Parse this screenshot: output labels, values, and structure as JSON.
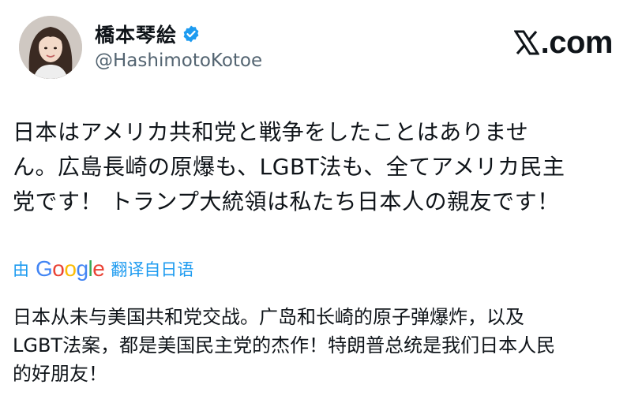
{
  "author": {
    "display_name": "橋本琴絵",
    "handle": "@HashimotoKotoe",
    "verified": true,
    "avatar_icon": "profile-photo-avatar"
  },
  "site": {
    "logo_text": ".com",
    "logo_icon": "x-logo-icon"
  },
  "post": {
    "original_lines": [
      "日本はアメリカ共和党と戦争をしたことはありませ",
      "ん。広島長崎の原爆も、LGBT法も、全てアメリカ民主",
      "党です！ トランプ大統領は私たち日本人の親友です！"
    ],
    "translation_prefix": "由",
    "translation_provider": "Google",
    "translation_suffix": "翻译自日语",
    "translated_lines": [
      "日本从未与美国共和党交战。广岛和长崎的原子弹爆炸，以及",
      "LGBT法案，都是美国民主党的杰作！特朗普总统是我们日本人民",
      "的好朋友！"
    ]
  },
  "colors": {
    "link_blue": "#1d9bf0",
    "handle_gray": "#536471",
    "text": "#0f1419"
  }
}
